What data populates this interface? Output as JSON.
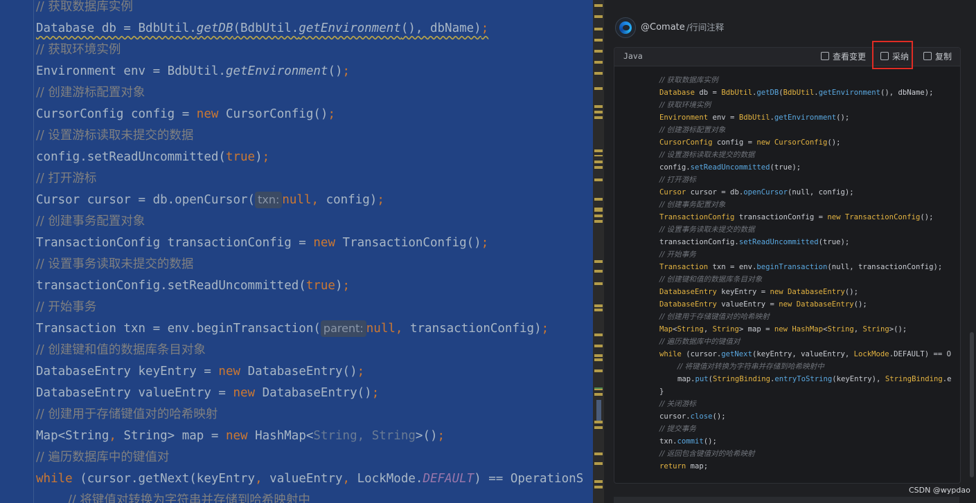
{
  "editor": {
    "lines": [
      {
        "type": "comment",
        "text": "// 获取数据库实例"
      },
      {
        "type": "code",
        "parts": [
          {
            "t": "Database db = BdbUtil."
          },
          {
            "t": "getDB",
            "c": "it"
          },
          {
            "t": "(BdbUtil."
          },
          {
            "t": "getEnvironment",
            "c": "it"
          },
          {
            "t": "(), dbName)"
          },
          {
            "t": ";",
            "c": "kw"
          }
        ],
        "wavy": true
      },
      {
        "type": "comment",
        "text": "// 获取环境实例"
      },
      {
        "type": "code",
        "parts": [
          {
            "t": "Environment env = BdbUtil."
          },
          {
            "t": "getEnvironment",
            "c": "it"
          },
          {
            "t": "()"
          },
          {
            "t": ";",
            "c": "kw"
          }
        ]
      },
      {
        "type": "comment",
        "text": "// 创建游标配置对象"
      },
      {
        "type": "code",
        "parts": [
          {
            "t": "CursorConfig config = "
          },
          {
            "t": "new ",
            "c": "kw"
          },
          {
            "t": "CursorConfig()"
          },
          {
            "t": ";",
            "c": "kw"
          }
        ]
      },
      {
        "type": "comment",
        "text": "// 设置游标读取未提交的数据"
      },
      {
        "type": "code",
        "parts": [
          {
            "t": "config.setReadUncommitted("
          },
          {
            "t": "true",
            "c": "kw"
          },
          {
            "t": ")"
          },
          {
            "t": ";",
            "c": "kw"
          }
        ]
      },
      {
        "type": "comment",
        "text": "// 打开游标"
      },
      {
        "type": "code",
        "parts": [
          {
            "t": "Cursor cursor = db.openCursor("
          },
          {
            "t": "txn:",
            "c": "hint"
          },
          {
            "t": "null, ",
            "c": "kw"
          },
          {
            "t": "config)"
          },
          {
            "t": ";",
            "c": "kw"
          }
        ]
      },
      {
        "type": "comment",
        "text": "// 创建事务配置对象"
      },
      {
        "type": "code",
        "parts": [
          {
            "t": "TransactionConfig transactionConfig = "
          },
          {
            "t": "new ",
            "c": "kw"
          },
          {
            "t": "TransactionConfig()"
          },
          {
            "t": ";",
            "c": "kw"
          }
        ]
      },
      {
        "type": "comment",
        "text": "// 设置事务读取未提交的数据"
      },
      {
        "type": "code",
        "parts": [
          {
            "t": "transactionConfig.setReadUncommitted("
          },
          {
            "t": "true",
            "c": "kw"
          },
          {
            "t": ")"
          },
          {
            "t": ";",
            "c": "kw"
          }
        ]
      },
      {
        "type": "comment",
        "text": "// 开始事务"
      },
      {
        "type": "code",
        "parts": [
          {
            "t": "Transaction txn = env.beginTransaction("
          },
          {
            "t": "parent:",
            "c": "hint"
          },
          {
            "t": "null, ",
            "c": "kw"
          },
          {
            "t": "transactionConfig)"
          },
          {
            "t": ";",
            "c": "kw"
          }
        ]
      },
      {
        "type": "comment",
        "text": "// 创建键和值的数据库条目对象"
      },
      {
        "type": "code",
        "parts": [
          {
            "t": "DatabaseEntry keyEntry = "
          },
          {
            "t": "new ",
            "c": "kw"
          },
          {
            "t": "DatabaseEntry()"
          },
          {
            "t": ";",
            "c": "kw"
          }
        ]
      },
      {
        "type": "code",
        "parts": [
          {
            "t": "DatabaseEntry valueEntry = "
          },
          {
            "t": "new ",
            "c": "kw"
          },
          {
            "t": "DatabaseEntry()"
          },
          {
            "t": ";",
            "c": "kw"
          }
        ]
      },
      {
        "type": "comment",
        "text": "// 创建用于存储键值对的哈希映射"
      },
      {
        "type": "code",
        "parts": [
          {
            "t": "Map<String"
          },
          {
            "t": ", ",
            "c": "kw"
          },
          {
            "t": "String> map = "
          },
          {
            "t": "new ",
            "c": "kw"
          },
          {
            "t": "HashMap<"
          },
          {
            "t": "String, String",
            "c": "generic"
          },
          {
            "t": ">()"
          },
          {
            "t": ";",
            "c": "kw"
          }
        ]
      },
      {
        "type": "comment",
        "text": "// 遍历数据库中的键值对"
      },
      {
        "type": "code",
        "parts": [
          {
            "t": "while ",
            "c": "kw"
          },
          {
            "t": "(cursor.getNext(keyEntry"
          },
          {
            "t": ", ",
            "c": "kw"
          },
          {
            "t": "valueEntry"
          },
          {
            "t": ", ",
            "c": "kw"
          },
          {
            "t": "LockMode."
          },
          {
            "t": "DEFAULT",
            "c": "constf"
          },
          {
            "t": ") == OperationS"
          }
        ]
      },
      {
        "type": "comment",
        "text": "// 将键值对转换为字符串并存储到哈希映射中",
        "indent": true
      }
    ]
  },
  "comate": {
    "user": "@Comate",
    "command": "/行间注释",
    "language": "Java",
    "diff_label": "查看变更",
    "accept_label": "采纳",
    "copy_label": "复制",
    "lines": [
      {
        "parts": [
          {
            "t": "// 获取数据库实例",
            "c": "cm"
          }
        ]
      },
      {
        "parts": [
          {
            "t": "Database",
            "c": "t"
          },
          {
            "t": " db = "
          },
          {
            "t": "BdbUtil",
            "c": "t"
          },
          {
            "t": "."
          },
          {
            "t": "getDB",
            "c": "m"
          },
          {
            "t": "("
          },
          {
            "t": "BdbUtil",
            "c": "t"
          },
          {
            "t": "."
          },
          {
            "t": "getEnvironment",
            "c": "m"
          },
          {
            "t": "(), dbName);"
          }
        ]
      },
      {
        "parts": [
          {
            "t": "// 获取环境实例",
            "c": "cm"
          }
        ]
      },
      {
        "parts": [
          {
            "t": "Environment",
            "c": "t"
          },
          {
            "t": " env = "
          },
          {
            "t": "BdbUtil",
            "c": "t"
          },
          {
            "t": "."
          },
          {
            "t": "getEnvironment",
            "c": "m"
          },
          {
            "t": "();"
          }
        ]
      },
      {
        "parts": [
          {
            "t": "// 创建游标配置对象",
            "c": "cm"
          }
        ]
      },
      {
        "parts": [
          {
            "t": "CursorConfig",
            "c": "t"
          },
          {
            "t": " config = "
          },
          {
            "t": "new",
            "c": "k"
          },
          {
            "t": " "
          },
          {
            "t": "CursorConfig",
            "c": "t"
          },
          {
            "t": "();"
          }
        ]
      },
      {
        "parts": [
          {
            "t": "// 设置游标读取未提交的数据",
            "c": "cm"
          }
        ]
      },
      {
        "parts": [
          {
            "t": "config."
          },
          {
            "t": "setReadUncommitted",
            "c": "m"
          },
          {
            "t": "(true);"
          }
        ]
      },
      {
        "parts": [
          {
            "t": "// 打开游标",
            "c": "cm"
          }
        ]
      },
      {
        "parts": [
          {
            "t": "Cursor",
            "c": "t"
          },
          {
            "t": " cursor = db."
          },
          {
            "t": "openCursor",
            "c": "m"
          },
          {
            "t": "(null, config);"
          }
        ]
      },
      {
        "parts": [
          {
            "t": "// 创建事务配置对象",
            "c": "cm"
          }
        ]
      },
      {
        "parts": [
          {
            "t": "TransactionConfig",
            "c": "t"
          },
          {
            "t": " transactionConfig = "
          },
          {
            "t": "new",
            "c": "k"
          },
          {
            "t": " "
          },
          {
            "t": "TransactionConfig",
            "c": "t"
          },
          {
            "t": "();"
          }
        ]
      },
      {
        "parts": [
          {
            "t": "// 设置事务读取未提交的数据",
            "c": "cm"
          }
        ]
      },
      {
        "parts": [
          {
            "t": "transactionConfig."
          },
          {
            "t": "setReadUncommitted",
            "c": "m"
          },
          {
            "t": "(true);"
          }
        ]
      },
      {
        "parts": [
          {
            "t": "// 开始事务",
            "c": "cm"
          }
        ]
      },
      {
        "parts": [
          {
            "t": "Transaction",
            "c": "t"
          },
          {
            "t": " txn = env."
          },
          {
            "t": "beginTransaction",
            "c": "m"
          },
          {
            "t": "(null, transactionConfig);"
          }
        ]
      },
      {
        "parts": [
          {
            "t": "// 创建键和值的数据库条目对象",
            "c": "cm"
          }
        ]
      },
      {
        "parts": [
          {
            "t": "DatabaseEntry",
            "c": "t"
          },
          {
            "t": " keyEntry = "
          },
          {
            "t": "new",
            "c": "k"
          },
          {
            "t": " "
          },
          {
            "t": "DatabaseEntry",
            "c": "t"
          },
          {
            "t": "();"
          }
        ]
      },
      {
        "parts": [
          {
            "t": "DatabaseEntry",
            "c": "t"
          },
          {
            "t": " valueEntry = "
          },
          {
            "t": "new",
            "c": "k"
          },
          {
            "t": " "
          },
          {
            "t": "DatabaseEntry",
            "c": "t"
          },
          {
            "t": "();"
          }
        ]
      },
      {
        "parts": [
          {
            "t": "// 创建用于存储键值对的哈希映射",
            "c": "cm"
          }
        ]
      },
      {
        "parts": [
          {
            "t": "Map",
            "c": "t"
          },
          {
            "t": "<"
          },
          {
            "t": "String",
            "c": "t"
          },
          {
            "t": ", "
          },
          {
            "t": "String",
            "c": "t"
          },
          {
            "t": "> map = "
          },
          {
            "t": "new",
            "c": "k"
          },
          {
            "t": " "
          },
          {
            "t": "HashMap",
            "c": "t"
          },
          {
            "t": "<"
          },
          {
            "t": "String",
            "c": "t"
          },
          {
            "t": ", "
          },
          {
            "t": "String",
            "c": "t"
          },
          {
            "t": ">();"
          }
        ]
      },
      {
        "parts": [
          {
            "t": "// 遍历数据库中的键值对",
            "c": "cm"
          }
        ]
      },
      {
        "parts": [
          {
            "t": "while",
            "c": "k"
          },
          {
            "t": " (cursor."
          },
          {
            "t": "getNext",
            "c": "m"
          },
          {
            "t": "(keyEntry, valueEntry, "
          },
          {
            "t": "LockMode",
            "c": "t"
          },
          {
            "t": ".DEFAULT) == O"
          }
        ]
      },
      {
        "parts": [
          {
            "t": "// 将键值对转换为字符串并存储到哈希映射中",
            "c": "cm"
          }
        ],
        "indent": true
      },
      {
        "parts": [
          {
            "t": "map."
          },
          {
            "t": "put",
            "c": "m"
          },
          {
            "t": "("
          },
          {
            "t": "StringBinding",
            "c": "t"
          },
          {
            "t": "."
          },
          {
            "t": "entryToString",
            "c": "m"
          },
          {
            "t": "(keyEntry), "
          },
          {
            "t": "StringBinding",
            "c": "t"
          },
          {
            "t": ".e"
          }
        ],
        "indent": true
      },
      {
        "parts": [
          {
            "t": "}"
          }
        ]
      },
      {
        "parts": [
          {
            "t": "// 关闭游标",
            "c": "cm"
          }
        ]
      },
      {
        "parts": [
          {
            "t": "cursor."
          },
          {
            "t": "close",
            "c": "m"
          },
          {
            "t": "();"
          }
        ]
      },
      {
        "parts": [
          {
            "t": "// 提交事务",
            "c": "cm"
          }
        ]
      },
      {
        "parts": [
          {
            "t": "txn."
          },
          {
            "t": "commit",
            "c": "m"
          },
          {
            "t": "();"
          }
        ]
      },
      {
        "parts": [
          {
            "t": "// 返回包含键值对的哈希映射",
            "c": "cm"
          }
        ]
      },
      {
        "parts": [
          {
            "t": "return",
            "c": "k"
          },
          {
            "t": " map;"
          }
        ]
      }
    ]
  },
  "watermark": "CSDN @wypdao",
  "colors": {
    "editor_bg": "#214283",
    "accent_red": "#e12c24",
    "keyword": "#cc7832"
  },
  "icons": [
    "comate-logo-icon",
    "diff-icon",
    "accept-icon",
    "copy-icon"
  ]
}
